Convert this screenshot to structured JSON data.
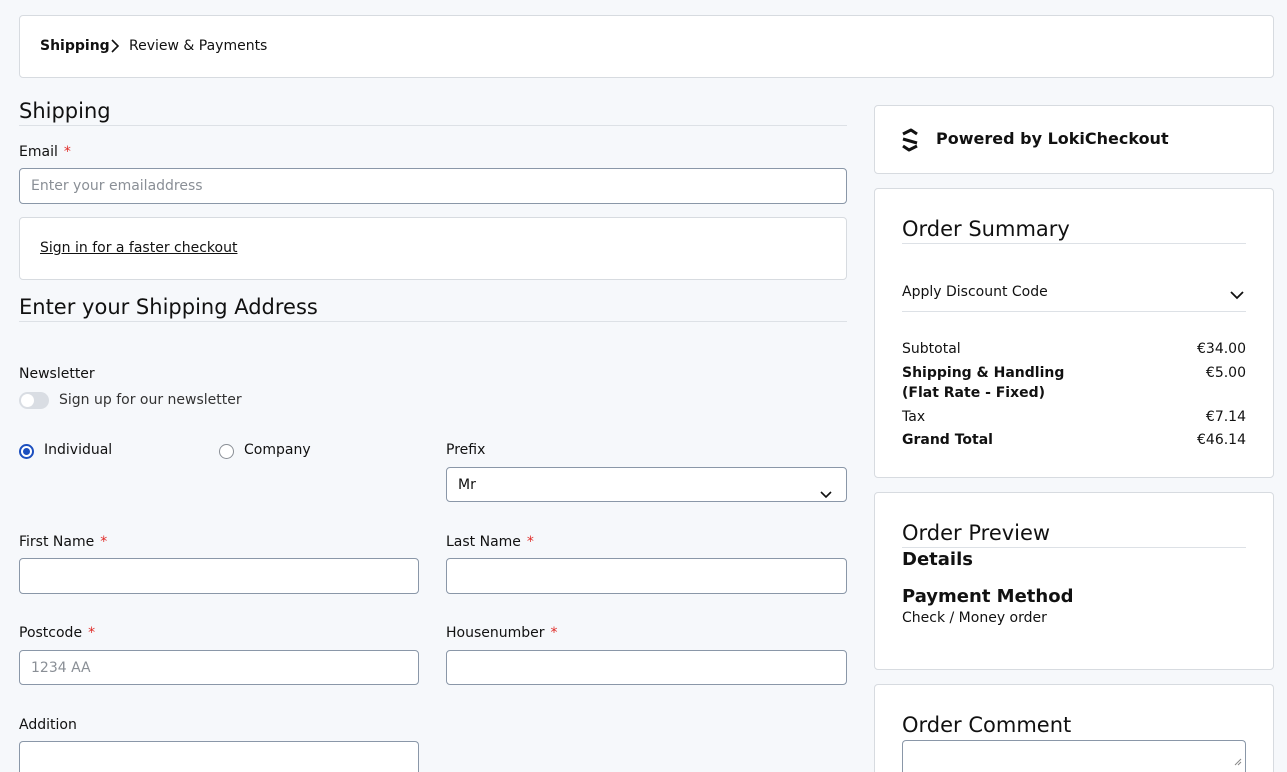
{
  "breadcrumb": {
    "step1": "Shipping",
    "step2": "Review & Payments"
  },
  "shipping": {
    "heading": "Shipping",
    "email_label": "Email",
    "email_placeholder": "Enter your emailaddress",
    "signin_link": "Sign in for a faster checkout",
    "address_heading": "Enter your Shipping Address",
    "newsletter_label": "Newsletter",
    "newsletter_toggle_label": "Sign up for our newsletter",
    "newsletter_on": false,
    "type_individual": "Individual",
    "type_company": "Company",
    "type_selected": "Individual",
    "prefix_label": "Prefix",
    "prefix_value": "Mr",
    "firstname_label": "First Name",
    "lastname_label": "Last Name",
    "postcode_label": "Postcode",
    "postcode_placeholder": "1234 AA",
    "housenumber_label": "Housenumber",
    "addition_label": "Addition",
    "required_mark": "*"
  },
  "sidebar": {
    "powered_by": "Powered by LokiCheckout",
    "order_summary": {
      "heading": "Order Summary",
      "discount_label": "Apply Discount Code",
      "rows": [
        {
          "label": "Subtotal",
          "value": "€34.00"
        },
        {
          "label": "Shipping & Handling (Flat Rate - Fixed)",
          "value": "€5.00"
        },
        {
          "label": "Tax",
          "value": "€7.14"
        },
        {
          "label": "Grand Total",
          "value": "€46.14"
        }
      ]
    },
    "order_preview": {
      "heading": "Order Preview",
      "details_heading": "Details",
      "payment_heading": "Payment Method",
      "payment_value": "Check / Money order"
    },
    "order_comment": {
      "heading": "Order Comment"
    }
  },
  "colors": {
    "accent": "#1c4fbf",
    "required": "#e02b27",
    "background": "#f6f8fb"
  }
}
